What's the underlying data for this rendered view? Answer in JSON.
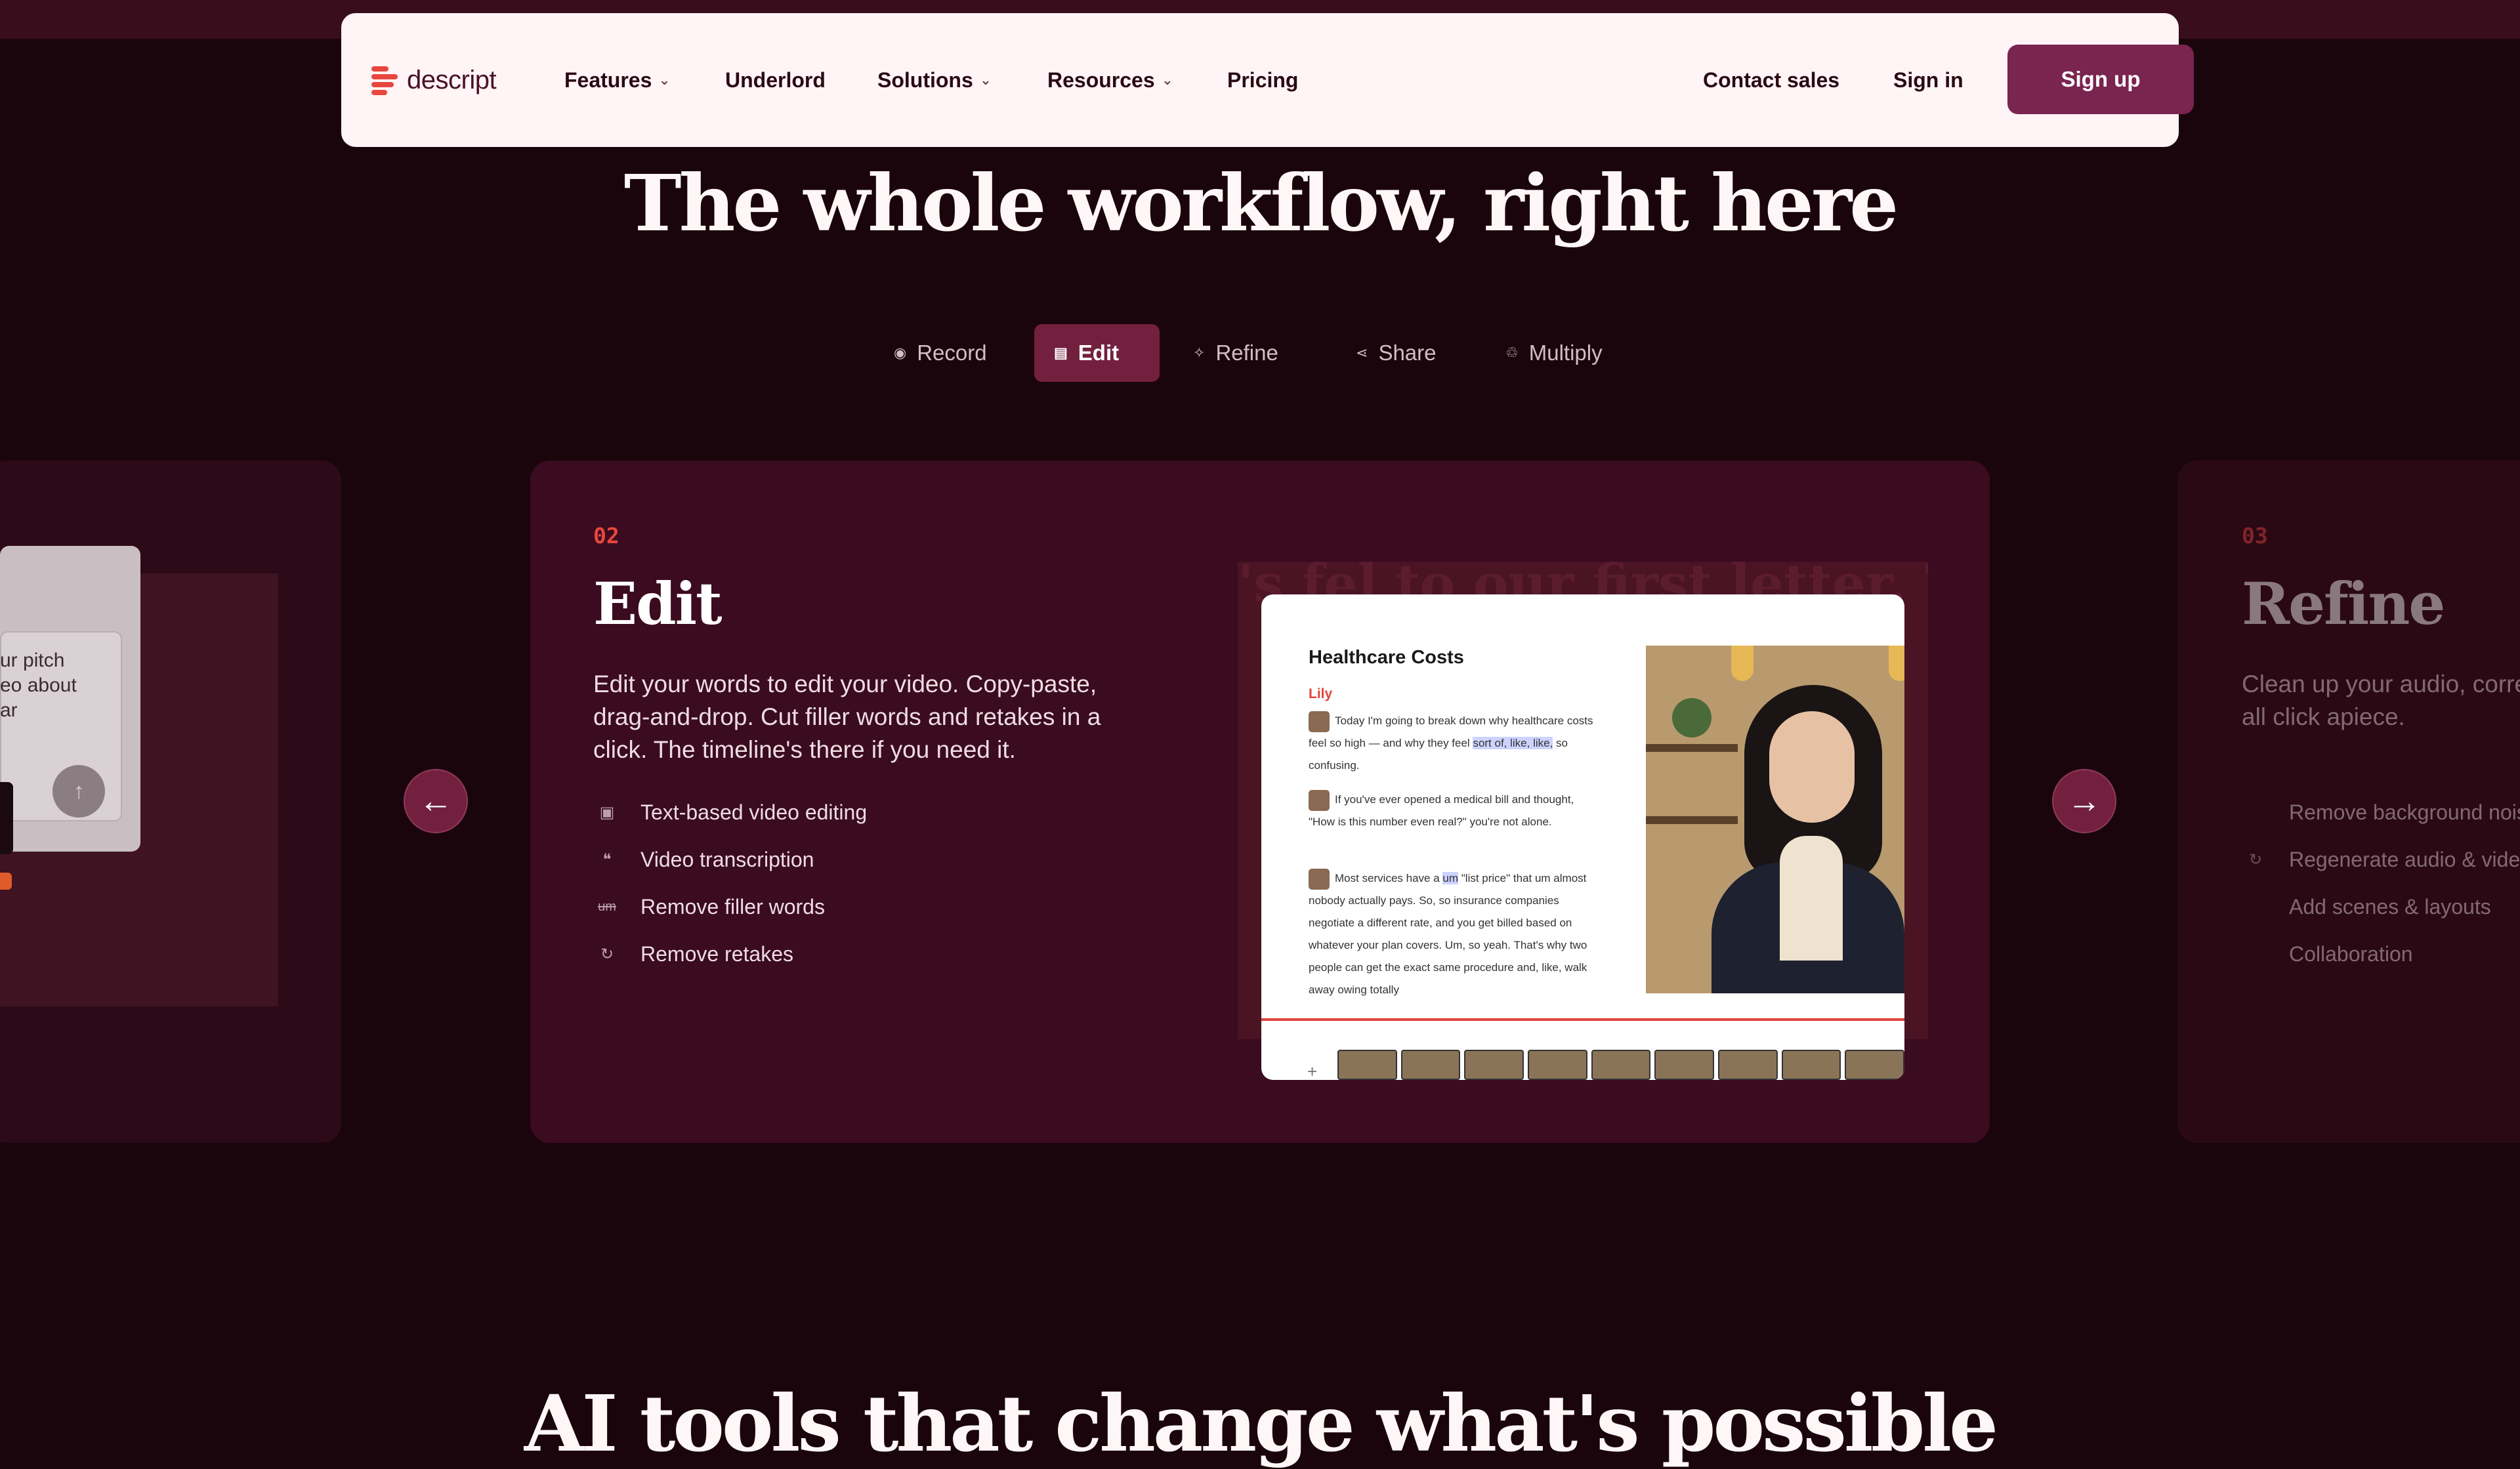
{
  "nav": {
    "logo_text": "descript",
    "items": [
      {
        "label": "Features",
        "chevron": true
      },
      {
        "label": "Underlord",
        "chevron": false
      },
      {
        "label": "Solutions",
        "chevron": true
      },
      {
        "label": "Resources",
        "chevron": true
      },
      {
        "label": "Pricing",
        "chevron": false
      }
    ],
    "contact_sales": "Contact sales",
    "sign_in": "Sign in",
    "sign_up": "Sign up"
  },
  "headline": "The whole workflow, right here",
  "tabs": [
    {
      "label": "Record",
      "icon": "record-icon",
      "glyph": "◉"
    },
    {
      "label": "Edit",
      "icon": "edit-icon",
      "glyph": "▤",
      "active": true
    },
    {
      "label": "Refine",
      "icon": "refine-icon",
      "glyph": "✧"
    },
    {
      "label": "Share",
      "icon": "share-icon",
      "glyph": "⋖"
    },
    {
      "label": "Multiply",
      "icon": "multiply-icon",
      "glyph": "♲"
    }
  ],
  "prev_card": {
    "snippet_lines": [
      "ur pitch",
      "eo about",
      "ar"
    ]
  },
  "main_card": {
    "number": "02",
    "title": "Edit",
    "description": "Edit your words to edit your video. Copy-paste, drag-and-drop. Cut filler words and retakes in a click. The timeline's there if you need it.",
    "features": [
      {
        "label": "Text-based video editing",
        "icon": "text-editing-icon",
        "glyph": "▣"
      },
      {
        "label": "Video transcription",
        "icon": "quote-icon",
        "glyph": "❝"
      },
      {
        "label": "Remove filler words",
        "icon": "filler-words-icon",
        "glyph": "um"
      },
      {
        "label": "Remove retakes",
        "icon": "retake-icon",
        "glyph": "↻"
      }
    ],
    "preview": {
      "doc_title": "Healthcare Costs",
      "speaker": "Lily",
      "background_text": "'s fel to our first letter. Th",
      "paragraphs": [
        {
          "before": "Today I'm going to break down why healthcare costs feel so high — and why they feel ",
          "highlight": "sort of, like, like,",
          "after": " so confusing."
        },
        {
          "before": "If you've ever opened a medical bill and thought, \"How is this number even real?\" you're not alone.",
          "highlight": "",
          "after": ""
        },
        {
          "before": "Most services have a ",
          "highlight": "um",
          "after": " \"list price\" that um almost nobody actually pays. So, so insurance companies negotiate a different rate, and you get billed based on whatever your plan covers. Um, so yeah. That's why two people can get the exact same procedure and, like, walk away owing totally"
        }
      ],
      "timeline_plus": "+"
    }
  },
  "next_card": {
    "number": "03",
    "title": "Refine",
    "description": "Clean up your audio, correct your lighting, smooth all click apiece.",
    "features": [
      {
        "label": "Remove background noise",
        "icon": "noise-icon",
        "glyph": ""
      },
      {
        "label": "Regenerate audio & video",
        "icon": "regenerate-icon",
        "glyph": "↻"
      },
      {
        "label": "Add scenes & layouts",
        "icon": "scenes-icon",
        "glyph": ""
      },
      {
        "label": "Collaboration",
        "icon": "collab-icon",
        "glyph": ""
      }
    ]
  },
  "arrows": {
    "prev": "←",
    "next": "→",
    "up": "↑"
  },
  "bottom_headline": "AI tools that change what's possible"
}
